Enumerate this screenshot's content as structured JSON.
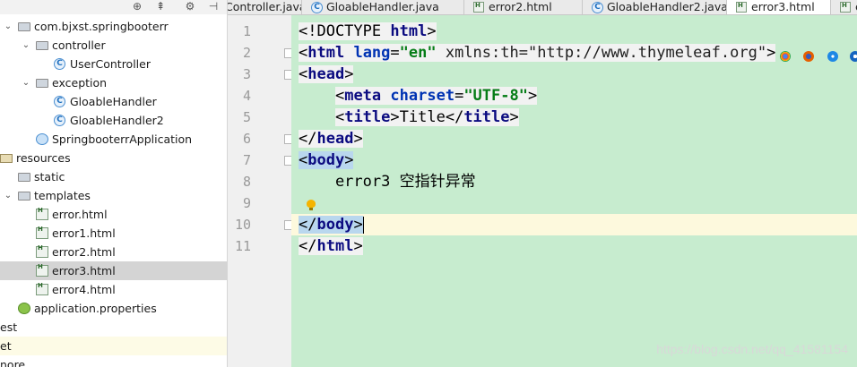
{
  "tree": {
    "toolbar_icons": [
      "target-icon",
      "collapse-icon",
      "gear-icon",
      "hide-icon"
    ],
    "rows": [
      {
        "label": "com.bjxst.springbooterr",
        "icon": "package",
        "arrow": "⌄",
        "indent": 0
      },
      {
        "label": "controller",
        "icon": "folder",
        "arrow": "⌄",
        "indent": 1
      },
      {
        "label": "UserController",
        "icon": "class",
        "arrow": "",
        "indent": 2
      },
      {
        "label": "exception",
        "icon": "folder",
        "arrow": "⌄",
        "indent": 1
      },
      {
        "label": "GloableHandler",
        "icon": "class",
        "arrow": "",
        "indent": 2
      },
      {
        "label": "GloableHandler2",
        "icon": "class",
        "arrow": "",
        "indent": 2
      },
      {
        "label": "SpringbooterrApplication",
        "icon": "app",
        "arrow": "",
        "indent": 1
      },
      {
        "label": "resources",
        "icon": "res",
        "arrow": "",
        "indent": -1
      },
      {
        "label": "static",
        "icon": "folder",
        "arrow": "",
        "indent": 0
      },
      {
        "label": "templates",
        "icon": "folder",
        "arrow": "⌄",
        "indent": 0
      },
      {
        "label": "error.html",
        "icon": "html",
        "arrow": "",
        "indent": 1
      },
      {
        "label": "error1.html",
        "icon": "html",
        "arrow": "",
        "indent": 1
      },
      {
        "label": "error2.html",
        "icon": "html",
        "arrow": "",
        "indent": 1
      },
      {
        "label": "error3.html",
        "icon": "html",
        "arrow": "",
        "indent": 1,
        "selected": true
      },
      {
        "label": "error4.html",
        "icon": "html",
        "arrow": "",
        "indent": 1
      },
      {
        "label": "application.properties",
        "icon": "prop",
        "arrow": "",
        "indent": 0
      },
      {
        "label": "est",
        "icon": "",
        "arrow": "",
        "indent": -2
      },
      {
        "label": "et",
        "icon": "",
        "arrow": "",
        "indent": -2,
        "highlight": true
      },
      {
        "label": "nore",
        "icon": "",
        "arrow": "",
        "indent": -2
      }
    ]
  },
  "tabs": [
    {
      "label": "Controller.java",
      "icon": "",
      "active": false
    },
    {
      "label": "GloableHandler.java",
      "icon": "class",
      "active": false
    },
    {
      "label": "error2.html",
      "icon": "html",
      "active": false
    },
    {
      "label": "GloableHandler2.java",
      "icon": "class",
      "active": false
    },
    {
      "label": "error3.html",
      "icon": "html",
      "active": true
    },
    {
      "label": "er",
      "icon": "html",
      "active": false
    }
  ],
  "editor": {
    "line_numbers": [
      "1",
      "2",
      "3",
      "4",
      "5",
      "6",
      "7",
      "8",
      "9",
      "10",
      "11"
    ],
    "current_line": 10,
    "lines": [
      [
        {
          "t": "<!DOCTYPE ",
          "c": "punc"
        },
        {
          "t": "html",
          "c": "tag"
        },
        {
          "t": ">",
          "c": "punc"
        }
      ],
      [
        {
          "t": "<",
          "c": "punc"
        },
        {
          "t": "html",
          "c": "tag"
        },
        {
          "t": " ",
          "c": "punc"
        },
        {
          "t": "lang",
          "c": "attr"
        },
        {
          "t": "=",
          "c": "punc"
        },
        {
          "t": "\"en\"",
          "c": "str"
        },
        {
          "t": " xmlns:th=\"http://www.thymeleaf.org\"",
          "c": "attr2"
        },
        {
          "t": ">",
          "c": "punc"
        }
      ],
      [
        {
          "t": "<",
          "c": "punc"
        },
        {
          "t": "head",
          "c": "tag"
        },
        {
          "t": ">",
          "c": "punc"
        }
      ],
      [
        {
          "t": "    ",
          "c": "punc"
        },
        {
          "t": "<",
          "c": "punc"
        },
        {
          "t": "meta",
          "c": "tag"
        },
        {
          "t": " ",
          "c": "punc"
        },
        {
          "t": "charset",
          "c": "attr"
        },
        {
          "t": "=",
          "c": "punc"
        },
        {
          "t": "\"UTF-8\"",
          "c": "str"
        },
        {
          "t": ">",
          "c": "punc"
        }
      ],
      [
        {
          "t": "    ",
          "c": "punc"
        },
        {
          "t": "<",
          "c": "punc"
        },
        {
          "t": "title",
          "c": "tag"
        },
        {
          "t": ">",
          "c": "punc"
        },
        {
          "t": "Title",
          "c": "txt"
        },
        {
          "t": "</",
          "c": "punc"
        },
        {
          "t": "title",
          "c": "tag"
        },
        {
          "t": ">",
          "c": "punc"
        }
      ],
      [
        {
          "t": "</",
          "c": "punc"
        },
        {
          "t": "head",
          "c": "tag"
        },
        {
          "t": ">",
          "c": "punc"
        }
      ],
      [
        {
          "t": "<",
          "c": "punc"
        },
        {
          "t": "body",
          "c": "tag"
        },
        {
          "t": ">",
          "c": "punc"
        }
      ],
      [
        {
          "t": "    error3 空指针异常",
          "c": "txt"
        }
      ],
      [],
      [
        {
          "t": "</",
          "c": "punc"
        },
        {
          "t": "body",
          "c": "tag"
        },
        {
          "t": ">",
          "c": "punc"
        }
      ],
      [
        {
          "t": "</",
          "c": "punc"
        },
        {
          "t": "html",
          "c": "tag"
        },
        {
          "t": ">",
          "c": "punc"
        }
      ]
    ],
    "browser_icons": [
      "chrome-icon",
      "firefox-icon",
      "safari-icon",
      "ie-icon"
    ]
  },
  "watermark": "https://blog.csdn.net/qq_41581154",
  "colors": {
    "code_bg": "#c7eccf",
    "gutter_bg": "#f0f0f0",
    "current_line": "#fdf9dd",
    "selected_row": "#d4d4d4",
    "tag": "#0b0b80",
    "string": "#067d17"
  }
}
